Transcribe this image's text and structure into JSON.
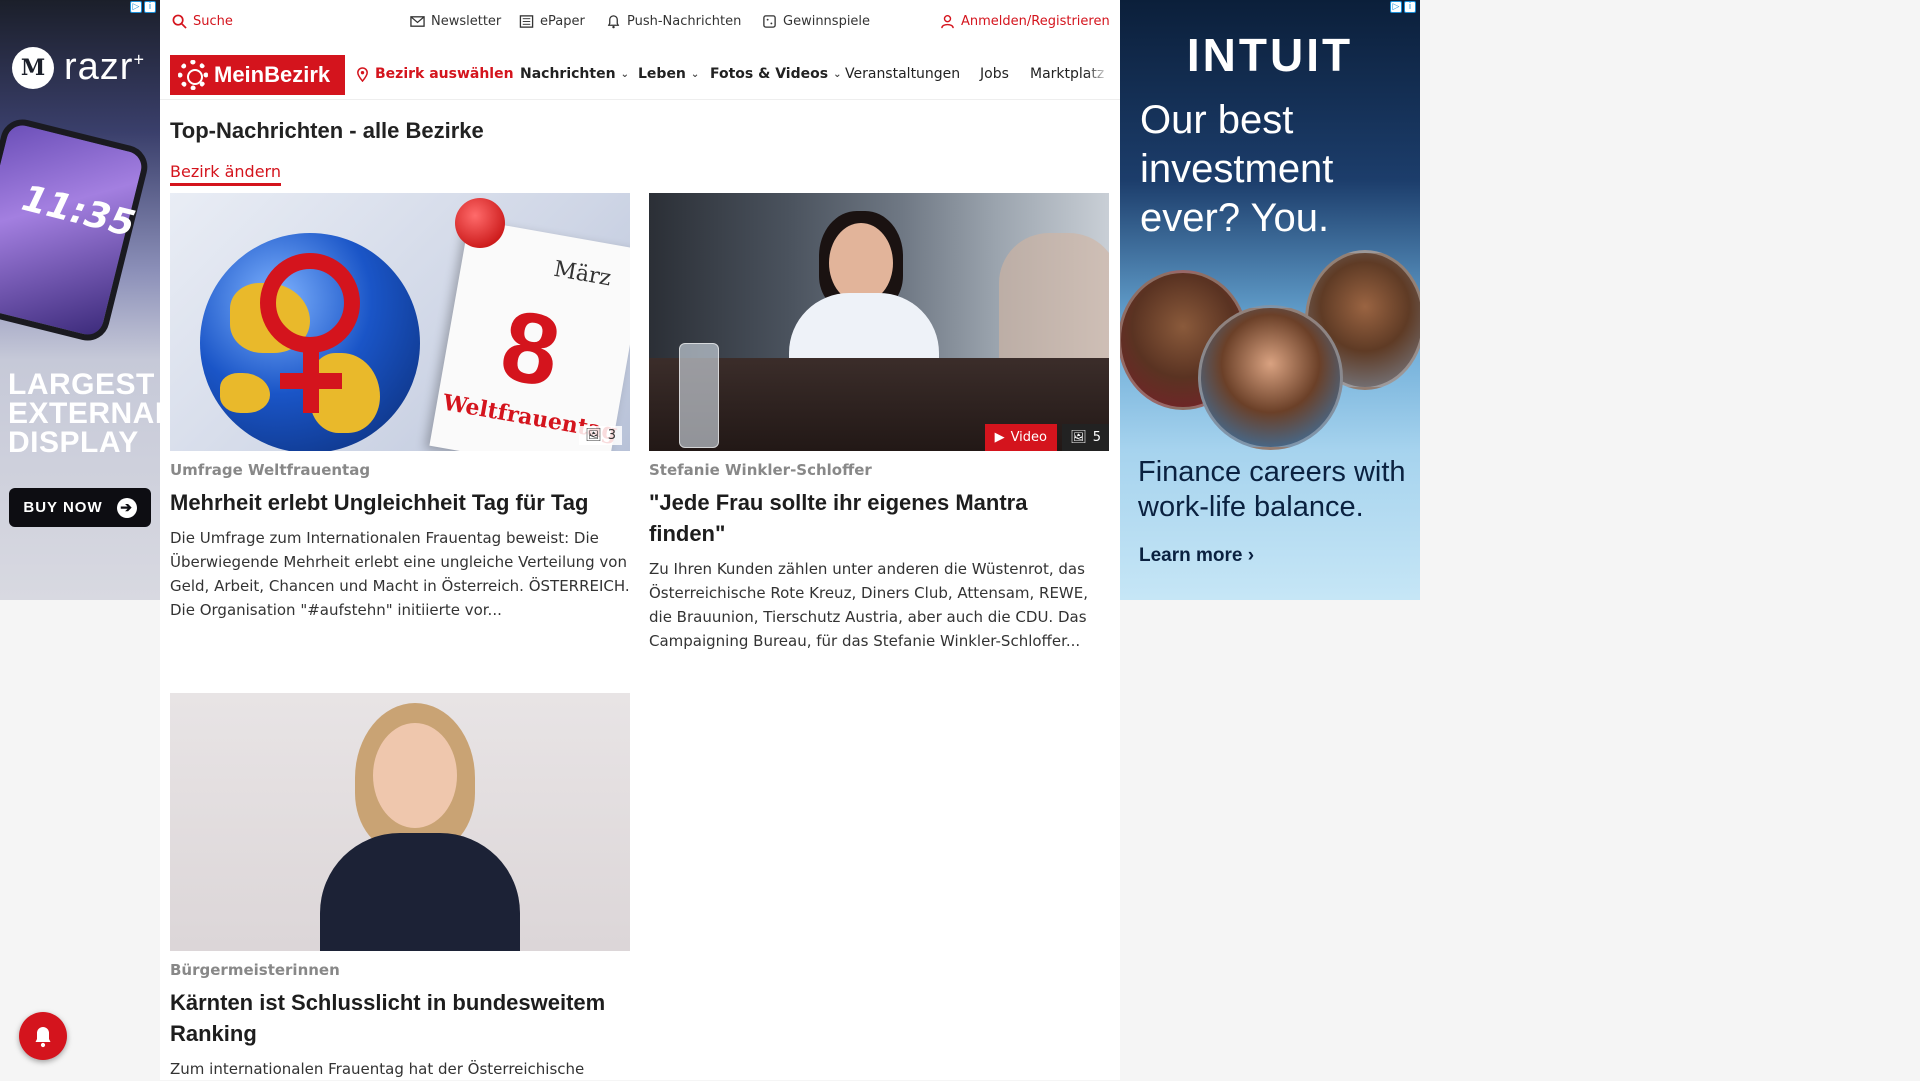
{
  "ads": {
    "left": {
      "brand": "razr",
      "brand_sup": "+",
      "phone_time": "11:35",
      "headline_lines": [
        "LARGEST",
        "EXTERNAL",
        "DISPLAY"
      ],
      "cta": "BUY NOW"
    },
    "right": {
      "brand": "INTUIT",
      "headline_lines": [
        "Our best",
        "investment",
        "ever? You."
      ],
      "sub_lines": [
        "Finance careers with",
        "work-life balance."
      ],
      "cta": "Learn more ›"
    }
  },
  "topbar": {
    "search": "Suche",
    "newsletter": "Newsletter",
    "epaper": "ePaper",
    "push": "Push-Nachrichten",
    "gewinnspiele": "Gewinnspiele",
    "login": "Anmelden/Registrieren"
  },
  "nav": {
    "logo": "MeinBezirk",
    "district": "Bezirk auswählen",
    "items": [
      {
        "label": "Nachrichten",
        "dropdown": true
      },
      {
        "label": "Leben",
        "dropdown": true
      },
      {
        "label": "Fotos & Videos",
        "dropdown": true
      },
      {
        "label": "Veranstaltungen",
        "dropdown": false
      },
      {
        "label": "Jobs",
        "dropdown": false
      },
      {
        "label": "Marktplatz",
        "dropdown": false
      }
    ]
  },
  "page": {
    "title": "Top-Nachrichten - alle Bezirke",
    "change_link": "Bezirk ändern"
  },
  "articles": [
    {
      "kicker": "Umfrage Weltfrauentag",
      "title": "Mehrheit erlebt Ungleichheit Tag für Tag",
      "text": "Die Umfrage zum Internationalen Frauentag beweist: Die Überwiegende Mehrheit erlebt eine ungleiche Verteilung von Geld, Arbeit, Chancen und Macht in Österreich. ÖSTERREICH. Die Organisation \"#aufstehn\" initiierte vor...",
      "photo_count": "3",
      "image": {
        "month": "März",
        "day": "8",
        "label": "Weltfrauentag"
      }
    },
    {
      "kicker": "Stefanie Winkler-Schloffer",
      "title": "\"Jede Frau sollte ihr eigenes Mantra finden\"",
      "text": "Zu Ihren Kunden zählen unter anderen die Wüstenrot, das Österreichische Rote Kreuz, Diners Club, Attensam, REWE, die Brauunion, Tierschutz Austria, aber auch die CDU. Das Campaigning Bureau, für das Stefanie Winkler-Schloffer...",
      "video_label": "Video",
      "photo_count": "5"
    },
    {
      "kicker": "Bürgermeisterinnen",
      "title": "Kärnten ist Schlusslicht in bundesweitem Ranking",
      "text": "Zum internationalen Frauentag hat der Österreichische"
    }
  ],
  "colors": {
    "brand_red": "#d4141d"
  }
}
